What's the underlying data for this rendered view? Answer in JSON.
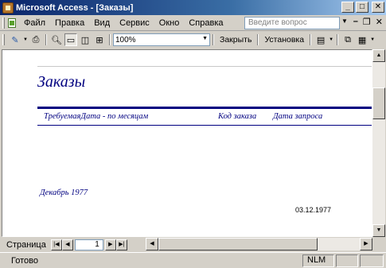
{
  "window": {
    "title": "Microsoft Access - [Заказы]"
  },
  "menu": {
    "items": [
      {
        "label": "Файл"
      },
      {
        "label": "Правка"
      },
      {
        "label": "Вид"
      },
      {
        "label": "Сервис"
      },
      {
        "label": "Окно"
      },
      {
        "label": "Справка"
      }
    ],
    "help_placeholder": "Введите вопрос"
  },
  "toolbar": {
    "zoom": "100%",
    "close_label": "Закрыть",
    "setup_label": "Установка"
  },
  "report": {
    "title": "Заказы",
    "col_header_1": "ТребуемаяДата - по месяцам",
    "col_header_2": "Код заказа",
    "col_header_3": "Дата запроса",
    "group_label": "Декабрь 1977",
    "date_value": "03.12.1977"
  },
  "navigation": {
    "page_label": "Страница",
    "current_page": "1"
  },
  "status": {
    "text": "Готово",
    "nlm": "NLM"
  },
  "colors": {
    "title_gradient_start": "#0a246a",
    "report_accent": "#000080"
  }
}
